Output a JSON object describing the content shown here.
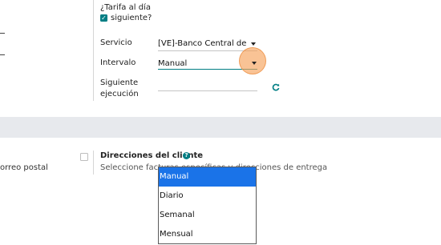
{
  "top": {
    "rate_next_day_label_line1": "¿Tarifa al día",
    "rate_next_day_label_line2": "siguiente?",
    "rate_next_day_checked": true,
    "service_label": "Servicio",
    "service_value": "[VE]-Banco Central de Venezuela",
    "interval_label": "Intervalo",
    "interval_value": "Manual",
    "next_run_label_line1": "Siguiente",
    "next_run_label_line2": "ejecución",
    "next_run_value": "",
    "refresh_icon": "refresh-icon"
  },
  "left_fragment": {
    "partial_label": "orreo postal"
  },
  "customer_addresses": {
    "title": "Direcciones del cliente",
    "help_icon": "question-circle-icon",
    "help_glyph": "?",
    "description": "Seleccione facturas específicas y direcciones de entrega"
  },
  "interval_dropdown": {
    "options": [
      "Manual",
      "Diario",
      "Semanal",
      "Mensual"
    ],
    "selected": "Manual"
  },
  "colors": {
    "accent": "#017e84",
    "selection": "#1a73e8",
    "band": "#e7e9ed",
    "click_indicator": "#f6a35c"
  }
}
